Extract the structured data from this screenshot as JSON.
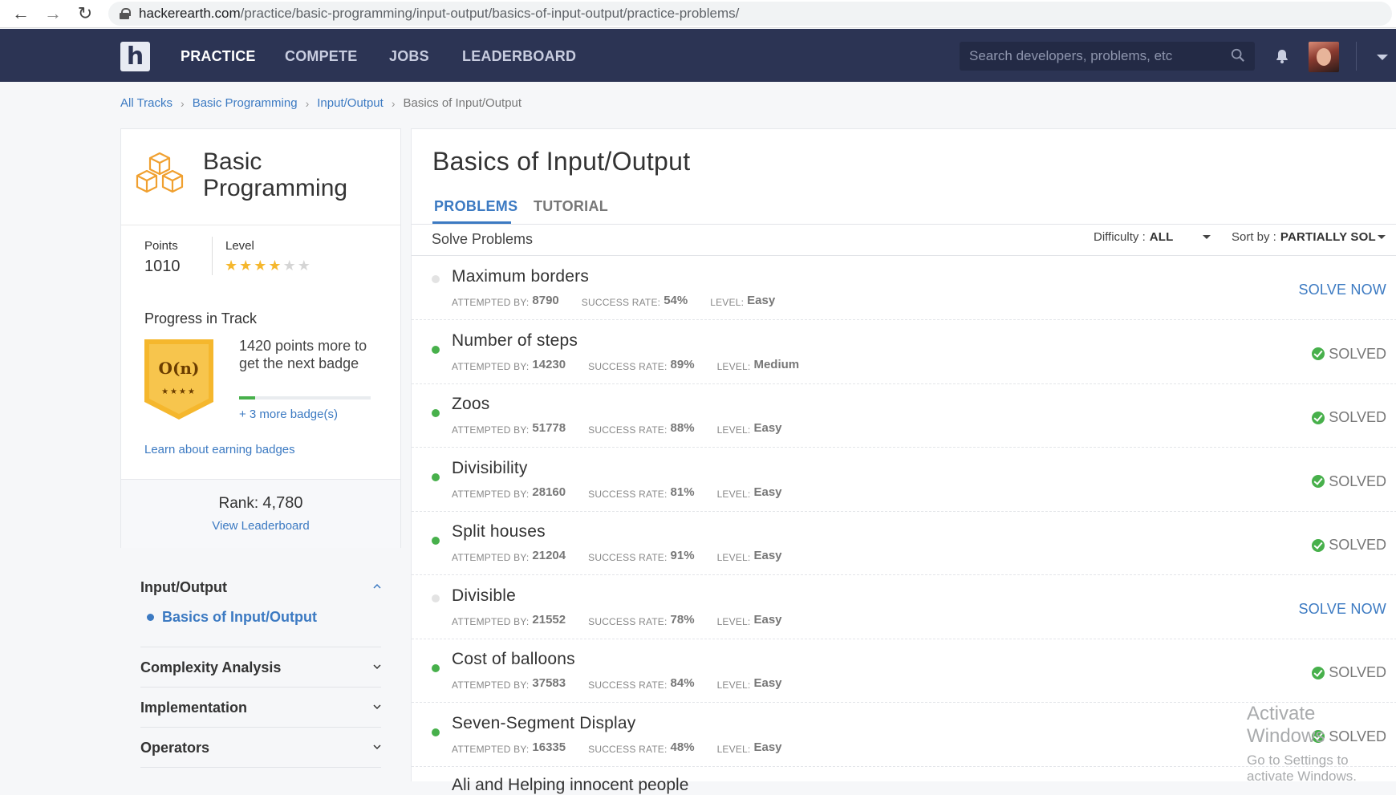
{
  "browser": {
    "url_domain": "hackerearth.com",
    "url_path": "/practice/basic-programming/input-output/basics-of-input-output/practice-problems/"
  },
  "nav": {
    "logo": "h",
    "links": [
      "PRACTICE",
      "COMPETE",
      "JOBS",
      "LEADERBOARD"
    ],
    "active": "PRACTICE",
    "search_placeholder": "Search developers, problems, etc"
  },
  "breadcrumb": [
    "All Tracks",
    "Basic Programming",
    "Input/Output",
    "Basics of Input/Output"
  ],
  "sidebar": {
    "track_title": "Basic Programming",
    "points_label": "Points",
    "points": "1010",
    "level_label": "Level",
    "level_stars": 4,
    "level_stars_max": 6,
    "progress_title": "Progress in Track",
    "badge_label": "O(n)",
    "badge_stars": "★★★★",
    "next_badge_text": "1420 points more to get the next badge",
    "progress_fraction": 0.12,
    "more_badges": "+ 3 more badge(s)",
    "learn_link": "Learn about earning badges",
    "rank_label": "Rank:",
    "rank": "4,780",
    "leaderboard_link": "View Leaderboard",
    "sections": [
      {
        "title": "Input/Output",
        "expanded": true,
        "items": [
          "Basics of Input/Output"
        ]
      },
      {
        "title": "Complexity Analysis",
        "expanded": false
      },
      {
        "title": "Implementation",
        "expanded": false
      },
      {
        "title": "Operators",
        "expanded": false
      }
    ]
  },
  "main": {
    "title": "Basics of Input/Output",
    "tabs": [
      "PROBLEMS",
      "TUTORIAL"
    ],
    "active_tab": "PROBLEMS",
    "solve_problems": "Solve Problems",
    "difficulty_label": "Difficulty :",
    "difficulty_value": "ALL",
    "sort_label": "Sort by :",
    "sort_value": "PARTIALLY SOL",
    "meta_labels": {
      "attempted": "ATTEMPTED BY:",
      "success": "SUCCESS RATE:",
      "level": "LEVEL:"
    },
    "solve_now_label": "SOLVE NOW",
    "solved_label": "SOLVED",
    "problems": [
      {
        "name": "Maximum borders",
        "attempted": "8790",
        "success": "54%",
        "level": "Easy",
        "status": "unsolved"
      },
      {
        "name": "Number of steps",
        "attempted": "14230",
        "success": "89%",
        "level": "Medium",
        "status": "solved"
      },
      {
        "name": "Zoos",
        "attempted": "51778",
        "success": "88%",
        "level": "Easy",
        "status": "solved"
      },
      {
        "name": "Divisibility",
        "attempted": "28160",
        "success": "81%",
        "level": "Easy",
        "status": "solved"
      },
      {
        "name": "Split houses",
        "attempted": "21204",
        "success": "91%",
        "level": "Easy",
        "status": "solved"
      },
      {
        "name": "Divisible",
        "attempted": "21552",
        "success": "78%",
        "level": "Easy",
        "status": "unsolved"
      },
      {
        "name": "Cost of balloons",
        "attempted": "37583",
        "success": "84%",
        "level": "Easy",
        "status": "solved"
      },
      {
        "name": "Seven-Segment Display",
        "attempted": "16335",
        "success": "48%",
        "level": "Easy",
        "status": "solved"
      }
    ],
    "partial_next": "Ali and Helping innocent people"
  },
  "watermark": {
    "line1": "Activate Windows",
    "line2": "Go to Settings to activate Windows."
  }
}
